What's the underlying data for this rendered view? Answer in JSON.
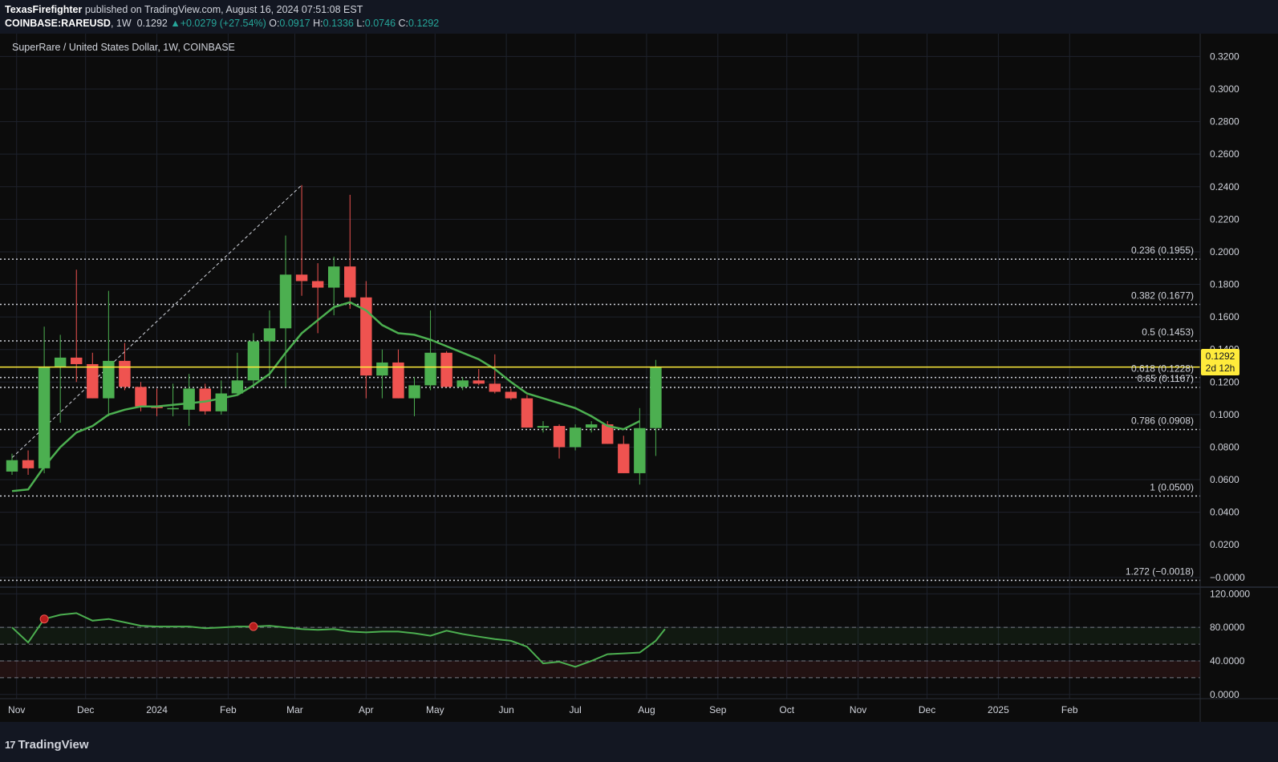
{
  "header": {
    "author": "TexasFirefighter",
    "published": "published on TradingView.com, August 16, 2024 07:51:08 EST",
    "symbol": "COINBASE:RAREUSD",
    "interval": "1W",
    "last": "0.1292",
    "change_arrow": "▲",
    "change": "+0.0279 (+27.54%)",
    "o_label": "O:",
    "o": "0.0917",
    "h_label": "H:",
    "h": "0.1336",
    "l_label": "L:",
    "l": "0.0746",
    "c_label": "C:",
    "c": "0.1292"
  },
  "legend": {
    "title": "SuperRare / United States Dollar, 1W, COINBASE"
  },
  "price_badge": {
    "price": "0.1292",
    "countdown": "2d 12h"
  },
  "footer": {
    "brand_mark": "17",
    "brand": "TradingView"
  },
  "colors": {
    "background": "#131722",
    "up": "#4caf50",
    "down": "#ef5350",
    "ma": "#4caf50",
    "price_line": "#ffeb3b",
    "grid": "#1e222d",
    "text": "#d1d4dc"
  },
  "chart_data": [
    {
      "type": "candlestick",
      "title": "SuperRare / United States Dollar, 1W, COINBASE",
      "y_ticks": [
        "0.3200",
        "0.3000",
        "0.2800",
        "0.2600",
        "0.2400",
        "0.2200",
        "0.2000",
        "0.1800",
        "0.1600",
        "0.1400",
        "0.1200",
        "0.1000",
        "0.0800",
        "0.0600",
        "0.0400",
        "0.0200",
        "−0.0000"
      ],
      "ylim": [
        -0.006,
        0.334
      ],
      "x_ticks": [
        "Nov",
        "Dec",
        "2024",
        "Feb",
        "Mar",
        "Apr",
        "May",
        "Jun",
        "Jul",
        "Aug",
        "Sep",
        "Oct",
        "Nov",
        "Dec",
        "2025",
        "Feb"
      ],
      "x_tick_dates": [
        "2023-11-01",
        "2023-12-01",
        "2024-01-01",
        "2024-02-01",
        "2024-03-01",
        "2024-04-01",
        "2024-05-01",
        "2024-06-01",
        "2024-07-01",
        "2024-08-01",
        "2024-09-01",
        "2024-10-01",
        "2024-11-01",
        "2024-12-01",
        "2025-01-01",
        "2025-02-01"
      ],
      "x_range": [
        "2023-10-30",
        "2025-03-27"
      ],
      "candles": [
        {
          "date": "2023-10-30",
          "open": 0.065,
          "high": 0.076,
          "low": 0.063,
          "close": 0.072
        },
        {
          "date": "2023-11-06",
          "open": 0.072,
          "high": 0.078,
          "low": 0.063,
          "close": 0.067
        },
        {
          "date": "2023-11-13",
          "open": 0.067,
          "high": 0.154,
          "low": 0.064,
          "close": 0.129
        },
        {
          "date": "2023-11-20",
          "open": 0.129,
          "high": 0.149,
          "low": 0.095,
          "close": 0.135
        },
        {
          "date": "2023-11-27",
          "open": 0.135,
          "high": 0.189,
          "low": 0.12,
          "close": 0.131
        },
        {
          "date": "2023-12-04",
          "open": 0.131,
          "high": 0.138,
          "low": 0.11,
          "close": 0.11
        },
        {
          "date": "2023-12-11",
          "open": 0.11,
          "high": 0.176,
          "low": 0.099,
          "close": 0.133
        },
        {
          "date": "2023-12-18",
          "open": 0.133,
          "high": 0.144,
          "low": 0.115,
          "close": 0.117
        },
        {
          "date": "2023-12-25",
          "open": 0.117,
          "high": 0.12,
          "low": 0.102,
          "close": 0.105
        },
        {
          "date": "2024-01-01",
          "open": 0.105,
          "high": 0.116,
          "low": 0.099,
          "close": 0.104
        },
        {
          "date": "2024-01-08",
          "open": 0.104,
          "high": 0.119,
          "low": 0.099,
          "close": 0.104
        },
        {
          "date": "2024-01-15",
          "open": 0.103,
          "high": 0.125,
          "low": 0.093,
          "close": 0.116
        },
        {
          "date": "2024-01-22",
          "open": 0.116,
          "high": 0.119,
          "low": 0.1,
          "close": 0.102
        },
        {
          "date": "2024-01-29",
          "open": 0.102,
          "high": 0.121,
          "low": 0.1,
          "close": 0.113
        },
        {
          "date": "2024-02-05",
          "open": 0.113,
          "high": 0.138,
          "low": 0.112,
          "close": 0.121
        },
        {
          "date": "2024-02-12",
          "open": 0.121,
          "high": 0.15,
          "low": 0.118,
          "close": 0.145
        },
        {
          "date": "2024-02-19",
          "open": 0.145,
          "high": 0.164,
          "low": 0.123,
          "close": 0.153
        },
        {
          "date": "2024-02-26",
          "open": 0.153,
          "high": 0.21,
          "low": 0.117,
          "close": 0.186
        },
        {
          "date": "2024-03-04",
          "open": 0.186,
          "high": 0.241,
          "low": 0.173,
          "close": 0.182
        },
        {
          "date": "2024-03-11",
          "open": 0.182,
          "high": 0.193,
          "low": 0.15,
          "close": 0.178
        },
        {
          "date": "2024-03-18",
          "open": 0.178,
          "high": 0.197,
          "low": 0.161,
          "close": 0.191
        },
        {
          "date": "2024-03-25",
          "open": 0.191,
          "high": 0.235,
          "low": 0.165,
          "close": 0.172
        },
        {
          "date": "2024-04-01",
          "open": 0.172,
          "high": 0.182,
          "low": 0.11,
          "close": 0.124
        },
        {
          "date": "2024-04-08",
          "open": 0.124,
          "high": 0.14,
          "low": 0.11,
          "close": 0.132
        },
        {
          "date": "2024-04-15",
          "open": 0.132,
          "high": 0.14,
          "low": 0.11,
          "close": 0.11
        },
        {
          "date": "2024-04-22",
          "open": 0.11,
          "high": 0.123,
          "low": 0.099,
          "close": 0.118
        },
        {
          "date": "2024-04-29",
          "open": 0.118,
          "high": 0.164,
          "low": 0.115,
          "close": 0.138
        },
        {
          "date": "2024-05-06",
          "open": 0.138,
          "high": 0.139,
          "low": 0.117,
          "close": 0.117
        },
        {
          "date": "2024-05-13",
          "open": 0.117,
          "high": 0.123,
          "low": 0.115,
          "close": 0.121
        },
        {
          "date": "2024-05-20",
          "open": 0.121,
          "high": 0.128,
          "low": 0.118,
          "close": 0.119
        },
        {
          "date": "2024-05-27",
          "open": 0.119,
          "high": 0.137,
          "low": 0.113,
          "close": 0.114
        },
        {
          "date": "2024-06-03",
          "open": 0.114,
          "high": 0.116,
          "low": 0.109,
          "close": 0.11
        },
        {
          "date": "2024-06-10",
          "open": 0.11,
          "high": 0.112,
          "low": 0.092,
          "close": 0.092
        },
        {
          "date": "2024-06-17",
          "open": 0.092,
          "high": 0.096,
          "low": 0.089,
          "close": 0.093
        },
        {
          "date": "2024-06-24",
          "open": 0.093,
          "high": 0.094,
          "low": 0.073,
          "close": 0.08
        },
        {
          "date": "2024-07-01",
          "open": 0.08,
          "high": 0.094,
          "low": 0.078,
          "close": 0.092
        },
        {
          "date": "2024-07-08",
          "open": 0.092,
          "high": 0.096,
          "low": 0.089,
          "close": 0.094
        },
        {
          "date": "2024-07-15",
          "open": 0.094,
          "high": 0.096,
          "low": 0.082,
          "close": 0.082
        },
        {
          "date": "2024-07-22",
          "open": 0.082,
          "high": 0.087,
          "low": 0.064,
          "close": 0.064
        },
        {
          "date": "2024-07-29",
          "open": 0.064,
          "high": 0.104,
          "low": 0.057,
          "close": 0.0917
        },
        {
          "date": "2024-08-05",
          "open": 0.0917,
          "high": 0.1336,
          "low": 0.0746,
          "close": 0.1292
        }
      ],
      "moving_average": [
        0.053,
        0.054,
        0.068,
        0.08,
        0.089,
        0.093,
        0.1,
        0.103,
        0.105,
        0.105,
        0.106,
        0.107,
        0.108,
        0.11,
        0.112,
        0.118,
        0.125,
        0.138,
        0.15,
        0.158,
        0.166,
        0.169,
        0.164,
        0.155,
        0.15,
        0.149,
        0.146,
        0.142,
        0.138,
        0.134,
        0.128,
        0.12,
        0.113,
        0.11,
        0.107,
        0.104,
        0.099,
        0.093,
        0.091,
        0.096
      ],
      "trend_line": {
        "from": {
          "date": "2023-10-30",
          "price": 0.0735
        },
        "to": {
          "date": "2024-03-04",
          "price": 0.241
        }
      },
      "fibonacci": [
        {
          "label": "0.236 (0.1955)",
          "price": 0.1955
        },
        {
          "label": "0.382 (0.1677)",
          "price": 0.1677
        },
        {
          "label": "0.5 (0.1453)",
          "price": 0.1453
        },
        {
          "label": "0.618 (0.1228)",
          "price": 0.1228
        },
        {
          "label": "0.65 (0.1167)",
          "price": 0.1167
        },
        {
          "label": "0.786 (0.0908)",
          "price": 0.0908
        },
        {
          "label": "1 (0.0500)",
          "price": 0.05
        },
        {
          "label": "1.272 (−0.0018)",
          "price": -0.0018
        }
      ],
      "last_price_line": 0.1292
    },
    {
      "type": "line",
      "y_ticks": [
        "120.0000",
        "80.0000",
        "40.0000",
        "0.0000"
      ],
      "ylim": [
        -5,
        128
      ],
      "bands": [
        20,
        40,
        60,
        80
      ],
      "values": [
        80,
        62,
        90,
        95,
        97,
        88,
        90,
        86,
        82,
        81,
        81,
        81,
        79,
        80,
        81,
        81,
        82,
        80,
        78,
        77,
        78,
        75,
        74,
        75,
        75,
        73,
        70,
        76,
        72,
        69,
        66,
        64,
        57,
        37,
        39,
        33,
        40,
        48,
        49,
        50,
        64,
        78
      ],
      "value_dates": [
        "2023-10-30",
        "2023-11-06",
        "2023-11-13",
        "2023-11-20",
        "2023-11-27",
        "2023-12-04",
        "2023-12-11",
        "2023-12-18",
        "2023-12-25",
        "2024-01-01",
        "2024-01-08",
        "2024-01-15",
        "2024-01-22",
        "2024-01-29",
        "2024-02-05",
        "2024-02-12",
        "2024-02-19",
        "2024-02-26",
        "2024-03-04",
        "2024-03-11",
        "2024-03-18",
        "2024-03-25",
        "2024-04-01",
        "2024-04-08",
        "2024-04-15",
        "2024-04-22",
        "2024-04-29",
        "2024-05-06",
        "2024-05-13",
        "2024-05-20",
        "2024-05-27",
        "2024-06-03",
        "2024-06-10",
        "2024-06-17",
        "2024-06-24",
        "2024-07-01",
        "2024-07-08",
        "2024-07-15",
        "2024-07-22",
        "2024-07-29",
        "2024-08-05",
        "2024-08-09"
      ],
      "markers": [
        {
          "date": "2023-11-13",
          "value": 90
        },
        {
          "date": "2024-02-12",
          "value": 81
        }
      ]
    }
  ]
}
